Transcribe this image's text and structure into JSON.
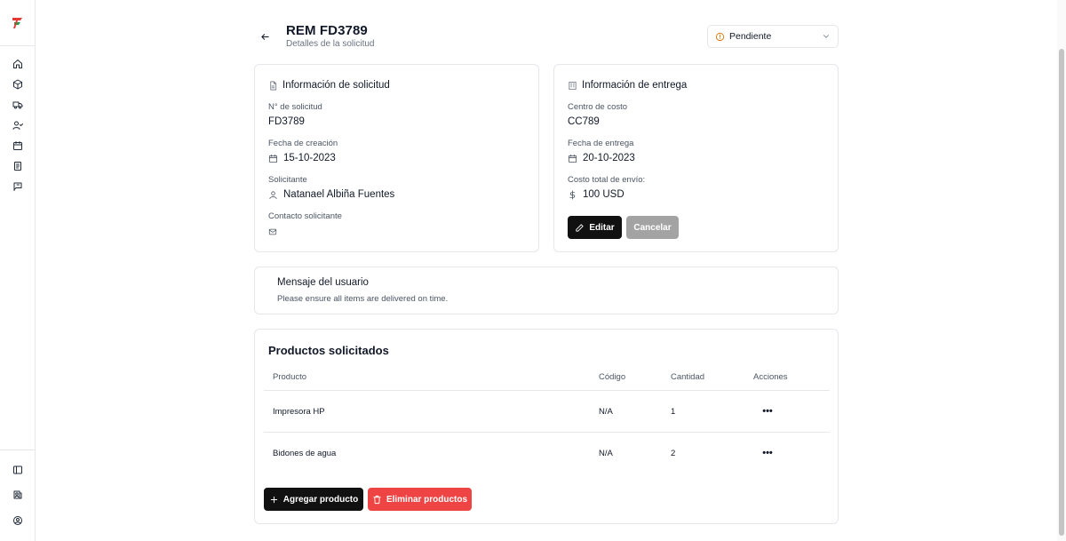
{
  "header": {
    "title": "REM FD3789",
    "subtitle": "Detalles de la solicitud",
    "status": "Pendiente"
  },
  "request_info": {
    "title": "Información de solicitud",
    "number_label": "N° de solicitud",
    "number_value": "FD3789",
    "created_label": "Fecha de creación",
    "created_value": "15-10-2023",
    "requester_label": "Solicitante",
    "requester_value": "Natanael Albiña Fuentes",
    "contact_label": "Contacto solicitante"
  },
  "delivery_info": {
    "title": "Información de entrega",
    "cost_center_label": "Centro de costo",
    "cost_center_value": "CC789",
    "delivery_date_label": "Fecha de entrega",
    "delivery_date_value": "20-10-2023",
    "shipping_cost_label": "Costo total de envío:",
    "shipping_cost_value": "100 USD",
    "edit_label": "Editar",
    "cancel_label": "Cancelar"
  },
  "message": {
    "title": "Mensaje del usuario",
    "text": "Please ensure all items are delivered on time."
  },
  "products": {
    "title": "Productos solicitados",
    "columns": [
      "Producto",
      "Código",
      "Cantidad",
      "Acciones"
    ],
    "rows": [
      {
        "product": "Impresora HP",
        "code": "N/A",
        "quantity": "1"
      },
      {
        "product": "Bidones de agua",
        "code": "N/A",
        "quantity": "2"
      }
    ],
    "add_label": "Agregar producto",
    "delete_label": "Eliminar productos"
  },
  "sidebar": {
    "icons": [
      "home-icon",
      "box-icon",
      "truck-icon",
      "users-icon",
      "calendar-icon",
      "document-icon",
      "message-flag-icon"
    ],
    "bottom_icons": [
      "panel-toggle-icon",
      "book-user-icon",
      "user-circle-icon"
    ]
  },
  "colors": {
    "primary_button": "#111111",
    "danger_button": "#ef4444",
    "disabled_button": "#a3a3a3",
    "status_icon": "#d97706",
    "logo_red": "#e53935",
    "logo_green": "#16a34a"
  }
}
